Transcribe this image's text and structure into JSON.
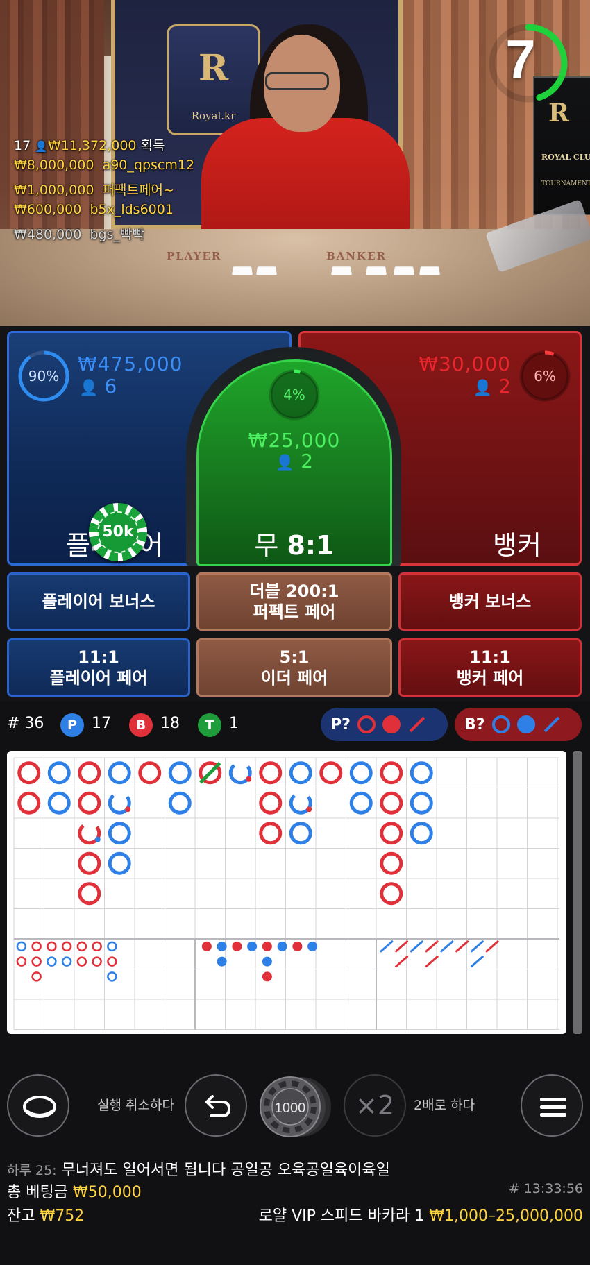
{
  "stream": {
    "crest_text": "Royal.kr",
    "table_labels": {
      "player": "PLAYER",
      "banker": "BANKER"
    },
    "royal_club_text": "ROYAL CLUB",
    "tournament_text": "TOURNAMENT",
    "timer": "7",
    "timer_fraction": 0.45
  },
  "winners": {
    "header": {
      "count": "17",
      "amount": "₩11,372,000",
      "suffix": "획득"
    },
    "list": [
      {
        "amount": "₩8,000,000",
        "name": "a90_qpscm12"
      },
      {
        "amount": "₩1,000,000",
        "name": "퍼팩트페어~"
      },
      {
        "amount": "₩600,000",
        "name": "b5x_lds6001"
      },
      {
        "amount": "₩480,000",
        "name": "bgs_빡빡"
      }
    ]
  },
  "bets": {
    "player": {
      "label": "플레이어",
      "percent": "90%",
      "percent_value": 0.9,
      "amount": "₩475,000",
      "count": "6"
    },
    "tie": {
      "label": "무",
      "odds": "8:1",
      "percent": "4%",
      "percent_value": 0.04,
      "amount": "₩25,000",
      "count": "2"
    },
    "banker": {
      "label": "뱅커",
      "percent": "6%",
      "percent_value": 0.06,
      "amount": "₩30,000",
      "count": "2"
    },
    "chip_label": "50k"
  },
  "side_bets": {
    "player_bonus": "플레이어 보너스",
    "perfect_pair_line1": "더블 200:1",
    "perfect_pair_line2": "퍼펙트 페어",
    "banker_bonus": "뱅커 보너스",
    "player_pair_line1": "11:1",
    "player_pair_line2": "플레이어 페어",
    "either_pair_line1": "5:1",
    "either_pair_line2": "이더 페어",
    "banker_pair_line1": "11:1",
    "banker_pair_line2": "뱅커 페어"
  },
  "stats": {
    "round": "# 36",
    "player_letter": "P",
    "player_count": "17",
    "banker_letter": "B",
    "banker_count": "18",
    "tie_letter": "T",
    "tie_count": "1",
    "player_ask": "P?",
    "banker_ask": "B?"
  },
  "roadmap": {
    "bead_road_columns": [
      [
        "B",
        "B"
      ],
      [
        "P",
        "P"
      ],
      [
        "B",
        "B",
        "B*",
        "B",
        "B"
      ],
      [
        "P",
        "P*",
        "P",
        "P"
      ],
      [
        "B"
      ],
      [
        "P",
        "P"
      ],
      [
        "T"
      ],
      [
        "P*"
      ],
      [
        "B",
        "B",
        "B"
      ],
      [
        "P",
        "P*",
        "P"
      ],
      [
        "B"
      ],
      [
        "P",
        "P"
      ],
      [
        "B",
        "B",
        "B",
        "B",
        "B"
      ],
      [
        "P",
        "P",
        "P"
      ]
    ]
  },
  "controls": {
    "undo_label": "실행 취소하다",
    "chip_value": "1000",
    "double_symbol": "×2",
    "double_label": "2배로 하다"
  },
  "footer": {
    "ticker_prefix": "하루 25:",
    "ticker_text": "무너져도 일어서면 됩니다 공일공 오육공일육이육일",
    "total_bet_label": "총 베팅금",
    "total_bet_value": "₩50,000",
    "round_id": "# 13:33:56",
    "balance_label": "잔고",
    "balance_value": "₩752",
    "table_name": "로얄 VIP 스피드 바카라 1",
    "limits": "₩1,000–25,000,000"
  },
  "colors": {
    "player": "#2d6ad6",
    "banker": "#d8343a",
    "tie": "#35d34a",
    "gold": "#ffd23f",
    "road_blue": "#2f80e6",
    "road_red": "#e0303a",
    "road_green": "#1f9d3a"
  }
}
